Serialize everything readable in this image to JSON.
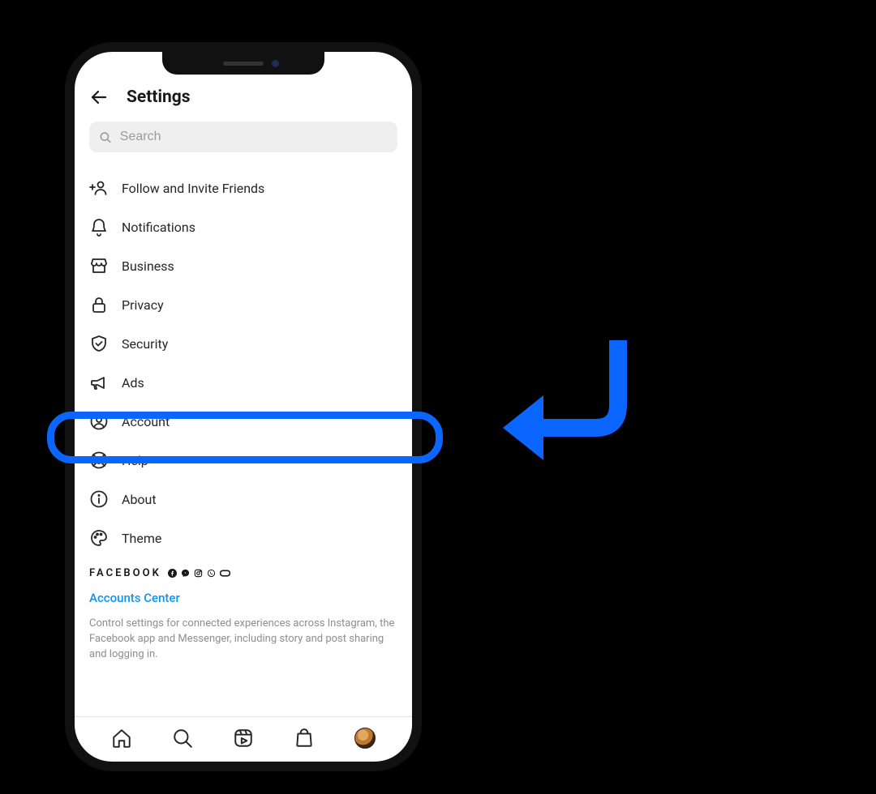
{
  "header": {
    "title": "Settings"
  },
  "search": {
    "placeholder": "Search"
  },
  "menu": {
    "items": [
      {
        "label": "Follow and Invite Friends"
      },
      {
        "label": "Notifications"
      },
      {
        "label": "Business"
      },
      {
        "label": "Privacy"
      },
      {
        "label": "Security"
      },
      {
        "label": "Ads"
      },
      {
        "label": "Account"
      },
      {
        "label": "Help"
      },
      {
        "label": "About"
      },
      {
        "label": "Theme"
      }
    ]
  },
  "brand": {
    "name": "FACEBOOK"
  },
  "accounts": {
    "link": "Accounts Center",
    "description": "Control settings for connected experiences across Instagram, the Facebook app and Messenger, including story and post sharing and logging in."
  },
  "annotation": {
    "highlight_target": "Account"
  }
}
